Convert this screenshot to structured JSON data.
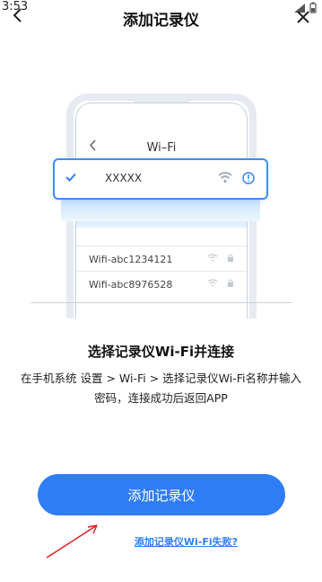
{
  "status_bar": {
    "time": "3:53"
  },
  "nav": {
    "title": "添加记录仪"
  },
  "illustration": {
    "phone_title": "Wi–Fi",
    "selected_network": "XXXXX",
    "networks": [
      "Wifi-abc1234121",
      "Wifi-abc8976528"
    ]
  },
  "content": {
    "heading": "选择记录仪Wi-Fi并连接",
    "description": "在手机系统 设置 > Wi-Fi > 选择记录仪Wi-Fi名称并输入密码，连接成功后返回APP"
  },
  "primary_button": {
    "label": "添加记录仪"
  },
  "fail_link": {
    "label": "添加记录仪Wi-Fi失败?"
  },
  "colors": {
    "accent": "#2f7df6",
    "arrow": "#e02020"
  }
}
